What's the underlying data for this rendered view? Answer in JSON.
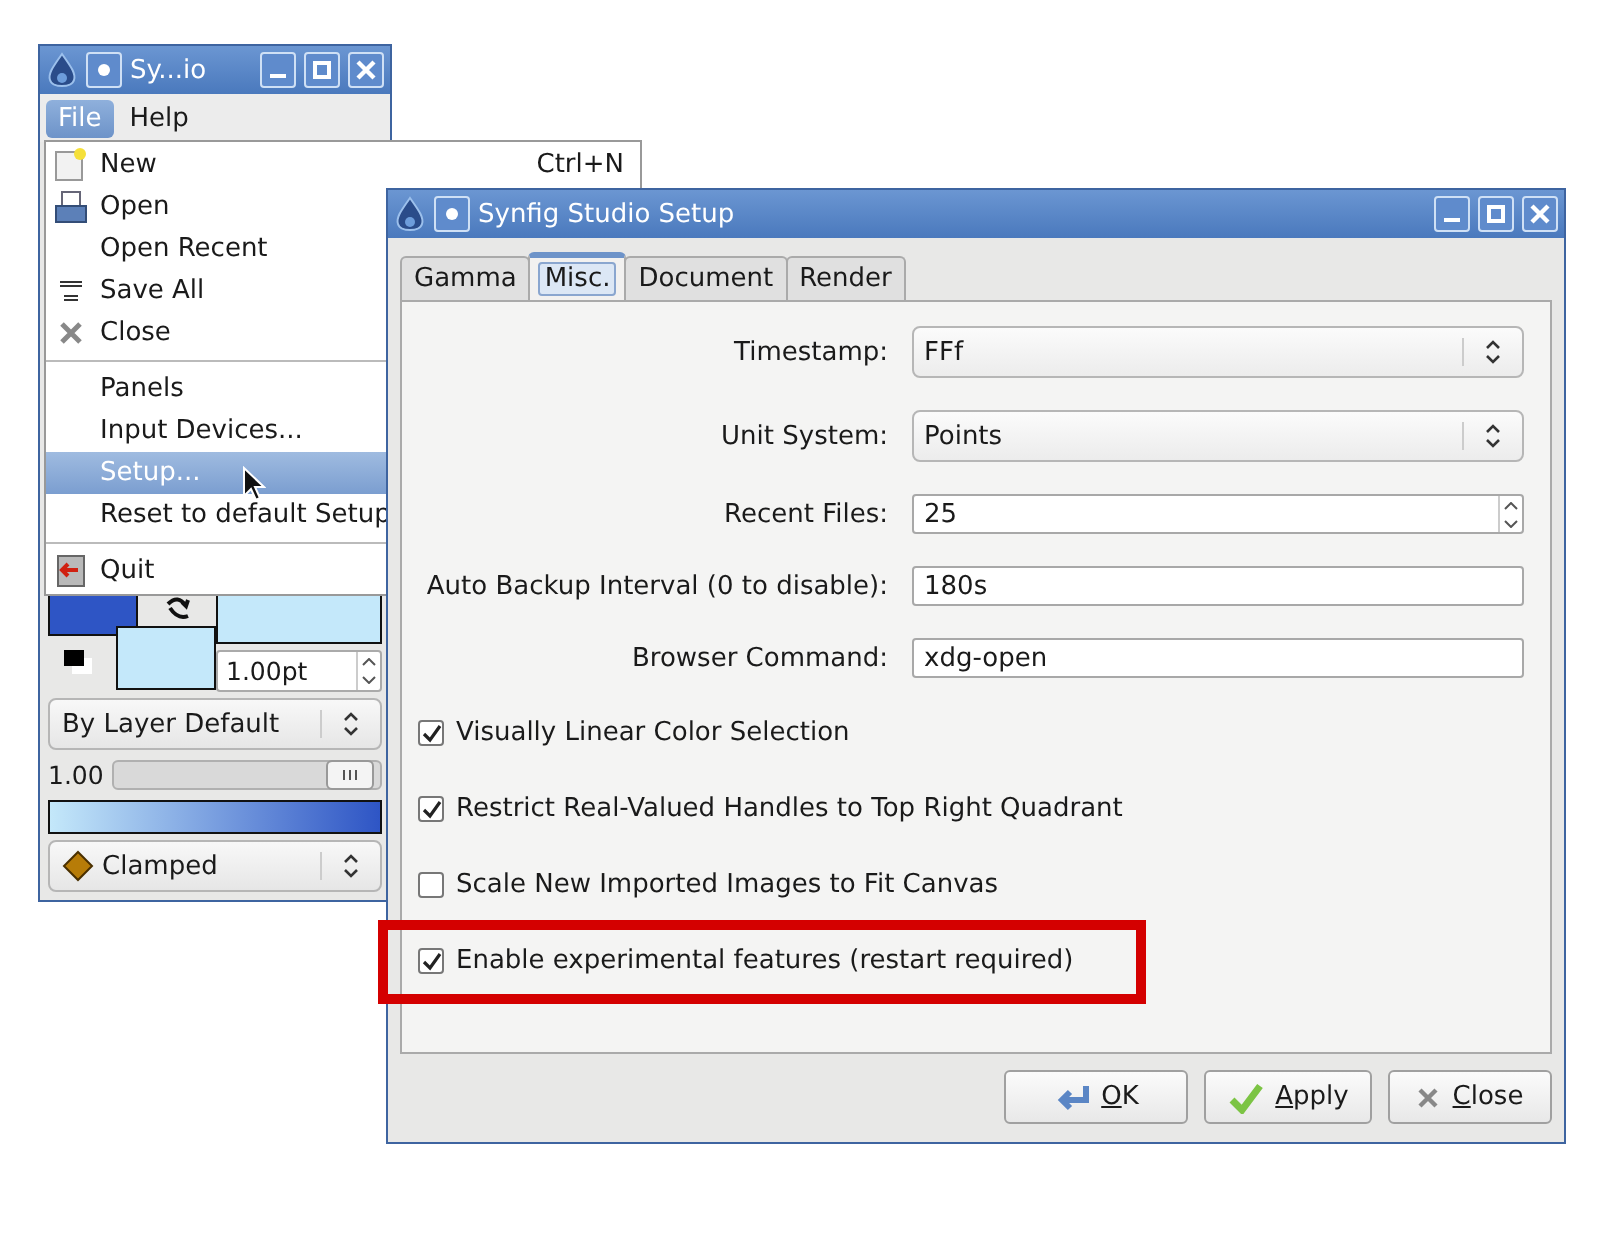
{
  "toolbox_window": {
    "title": "Sy...io",
    "menubar": [
      {
        "label": "File",
        "selected": true
      },
      {
        "label": "Help",
        "selected": false
      }
    ],
    "width_field": {
      "value": "1.00pt"
    },
    "blend_method": "By Layer Default",
    "opacity": {
      "reading": "1.00",
      "level": 0.96
    },
    "interpolation": "Clamped"
  },
  "file_menu": {
    "items": [
      {
        "kind": "item",
        "label": "New",
        "shortcut": "Ctrl+N",
        "selected": false
      },
      {
        "kind": "item",
        "label": "Open",
        "selected": false
      },
      {
        "kind": "item",
        "label": "Open Recent",
        "selected": false
      },
      {
        "kind": "item",
        "label": "Save All",
        "selected": false
      },
      {
        "kind": "item",
        "label": "Close",
        "selected": false
      },
      {
        "kind": "separator"
      },
      {
        "kind": "item",
        "label": "Panels",
        "selected": false
      },
      {
        "kind": "item",
        "label": "Input Devices...",
        "selected": false
      },
      {
        "kind": "item",
        "label": "Setup...",
        "selected": true
      },
      {
        "kind": "item",
        "label": "Reset to default Setup",
        "selected": false
      },
      {
        "kind": "separator"
      },
      {
        "kind": "item",
        "label": "Quit",
        "selected": false
      }
    ]
  },
  "setup_dialog": {
    "title": "Synfig Studio Setup",
    "tabs": [
      {
        "label": "Gamma",
        "selected": false
      },
      {
        "label": "Misc.",
        "selected": true
      },
      {
        "label": "Document",
        "selected": false
      },
      {
        "label": "Render",
        "selected": false
      }
    ],
    "fields": [
      {
        "kind": "combo",
        "label": "Timestamp:",
        "value": "FFf"
      },
      {
        "kind": "combo",
        "label": "Unit System:",
        "value": "Points"
      },
      {
        "kind": "spin",
        "label": "Recent Files:",
        "value": "25"
      },
      {
        "kind": "text",
        "label": "Auto Backup Interval (0 to disable):",
        "value": "180s"
      },
      {
        "kind": "text",
        "label": "Browser Command:",
        "value": "xdg-open"
      }
    ],
    "checkboxes": [
      {
        "label": "Visually Linear Color Selection",
        "checked": true,
        "highlighted": false
      },
      {
        "label": "Restrict Real-Valued Handles to Top Right Quadrant",
        "checked": true,
        "highlighted": false
      },
      {
        "label": "Scale New Imported Images to Fit Canvas",
        "checked": false,
        "highlighted": false
      },
      {
        "label": "Enable experimental features (restart required)",
        "checked": true,
        "highlighted": true
      }
    ],
    "buttons": [
      {
        "kind": "ok",
        "label": "OK"
      },
      {
        "kind": "apply",
        "label": "Apply"
      },
      {
        "kind": "close",
        "label": "Close"
      }
    ]
  }
}
